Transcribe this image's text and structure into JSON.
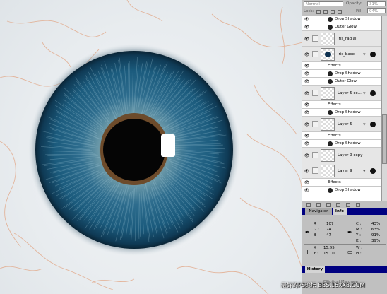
{
  "app": {
    "blend_mode": "Normal",
    "opacity_label": "Opacity:",
    "opacity_value": "31%",
    "lock_label": "Lock:",
    "fill_label": "Fill:",
    "fill_value": "94%"
  },
  "layers": [
    {
      "kind": "effect",
      "text": "Drop Shadow"
    },
    {
      "kind": "effect",
      "text": "Outer Glow"
    },
    {
      "kind": "layer",
      "name": "iris_radial",
      "has_fx": false
    },
    {
      "kind": "layer",
      "name": "iris_base",
      "has_fx": true,
      "thumb": "iris"
    },
    {
      "kind": "effects-label",
      "text": "Effects"
    },
    {
      "kind": "effect",
      "text": "Drop Shadow"
    },
    {
      "kind": "effect",
      "text": "Outer Glow"
    },
    {
      "kind": "layer",
      "name": "Layer 5 co...",
      "has_fx": true
    },
    {
      "kind": "effects-label",
      "text": "Effects"
    },
    {
      "kind": "effect",
      "text": "Drop Shadow"
    },
    {
      "kind": "layer",
      "name": "Layer 5",
      "has_fx": true
    },
    {
      "kind": "effects-label",
      "text": "Effects"
    },
    {
      "kind": "effect",
      "text": "Drop Shadow"
    },
    {
      "kind": "layer",
      "name": "Layer 9 copy",
      "has_fx": false
    },
    {
      "kind": "layer",
      "name": "Layer 9",
      "has_fx": true
    },
    {
      "kind": "effects-label",
      "text": "Effects"
    },
    {
      "kind": "effect",
      "text": "Drop Shadow"
    }
  ],
  "nav": {
    "tab_navigator": "Navigator",
    "tab_info": "Info"
  },
  "info": {
    "rgb": {
      "r_label": "R :",
      "r": "107",
      "g_label": "G :",
      "g": "74",
      "b_label": "B :",
      "b": "47"
    },
    "cmyk": {
      "c_label": "C :",
      "c": "43%",
      "m_label": "M :",
      "m": "63%",
      "y_label": "Y :",
      "y": "91%",
      "k_label": "K :",
      "k": "39%"
    },
    "pos": {
      "x_label": "X :",
      "x": "15.95",
      "y_label": "Y :",
      "y": "15.10"
    },
    "size": {
      "w_label": "W :",
      "w": "",
      "h_label": "H :",
      "h": ""
    }
  },
  "history": {
    "title": "History",
    "item": "Elliptical Marquee"
  },
  "watermark": "最好的PS论坛 BBS.16XX8.COM",
  "colors": {
    "panel": "#c0c0c0",
    "title_bar": "#000080",
    "iris": "#1b5b7d",
    "vein": "#e0a080"
  }
}
